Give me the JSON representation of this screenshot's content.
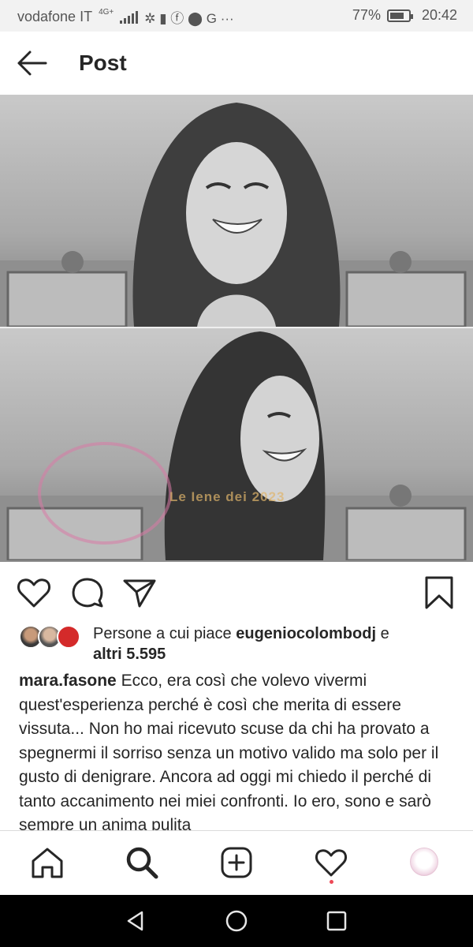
{
  "status_bar": {
    "carrier": "vodafone IT",
    "network": "4G+",
    "extra_glyphs": "✲ ▮ ⓕ ⬤ G ···",
    "battery_percent": "77%",
    "battery_level": 0.77,
    "time": "20:42"
  },
  "header": {
    "back_icon": "arrow-left-icon",
    "title": "Post"
  },
  "watermark_text": "Le Iene dei 2023",
  "actions": {
    "like_icon": "heart-icon",
    "comment_icon": "comment-icon",
    "share_icon": "paper-plane-icon",
    "save_icon": "bookmark-icon"
  },
  "likes": {
    "prefix": "Persone a cui piace",
    "user": "eugeniocolombodj",
    "joiner": "e",
    "others": "altri 5.595"
  },
  "caption": {
    "username": "mara.fasone",
    "text": "Ecco, era così che volevo vivermi quest'esperienza perché è così che merita di essere vissuta... Non ho mai ricevuto scuse da chi ha provato a spegnermi il sorriso senza un motivo valido ma solo per il gusto di denigrare. Ancora ad oggi mi chiedo il perché di tanto accanimento nei miei confronti. Io ero, sono e sarò sempre un anima pulita"
  },
  "bottom_nav": {
    "items": [
      "home-icon",
      "search-icon",
      "new-post-icon",
      "activity-heart-icon",
      "profile-avatar"
    ]
  },
  "colors": {
    "text": "#262626",
    "notification_dot": "#ed4956",
    "status_bg": "#f2f2f2"
  }
}
